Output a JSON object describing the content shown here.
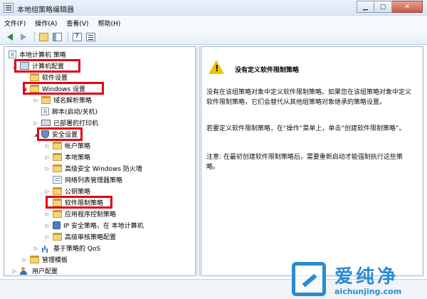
{
  "window": {
    "title": "本地组策略编辑器",
    "controls": {
      "minimize": "▁",
      "maximize": "▢",
      "close": "✕"
    }
  },
  "menubar": {
    "items": [
      "文件(F)",
      "操作(A)",
      "查看(V)",
      "帮助(H)"
    ]
  },
  "toolbar": {
    "buttons": [
      "back-arrow-icon",
      "forward-arrow-icon",
      "up-folder-icon",
      "show-hide-tree-icon",
      "help-icon",
      "properties-icon"
    ]
  },
  "tree": {
    "root": "本地计算机 策略",
    "computer_config": "计算机配置",
    "software_settings": "软件设置",
    "windows_settings": "Windows 设置",
    "name_resolution": "域名解析策略",
    "scripts": "脚本(启动/关机)",
    "deployed_printers": "已部署的打印机",
    "security_settings": "安全设置",
    "account_policies": "帐户策略",
    "local_policies": "本地策略",
    "firewall": "高级安全 Windows 防火墙",
    "network_list": "网络列表管理器策略",
    "public_key": "公钥策略",
    "software_restriction": "软件限制策略",
    "applocker": "应用程序控制策略",
    "ipsec": "IP 安全策略，在 本地计算机",
    "audit": "高级审核策略配置",
    "qos": "基于策略的 QoS",
    "admin_templates": "管理模板",
    "user_config": "用户配置"
  },
  "detail": {
    "heading": "没有定义软件限制策略",
    "para1": "没有在该组策略对象中定义软件限制策略。如果您在该组策略对象中定义软件限制策略，它们会替代从其他组策略对象继承的策略设置。",
    "para2": "若要定义软件限制策略，在“操作”菜单上，单击“创建软件限制策略”。",
    "para3": "注意: 在最初创建软件限制策略后，需要重新启动才能强制执行这些策略。"
  },
  "watermark": {
    "brand": "爱纯净",
    "url": "aichunjing.com"
  },
  "colors": {
    "highlight_box": "#e30012",
    "watermark": "#2a8bd3",
    "warning": "#f2c200"
  }
}
